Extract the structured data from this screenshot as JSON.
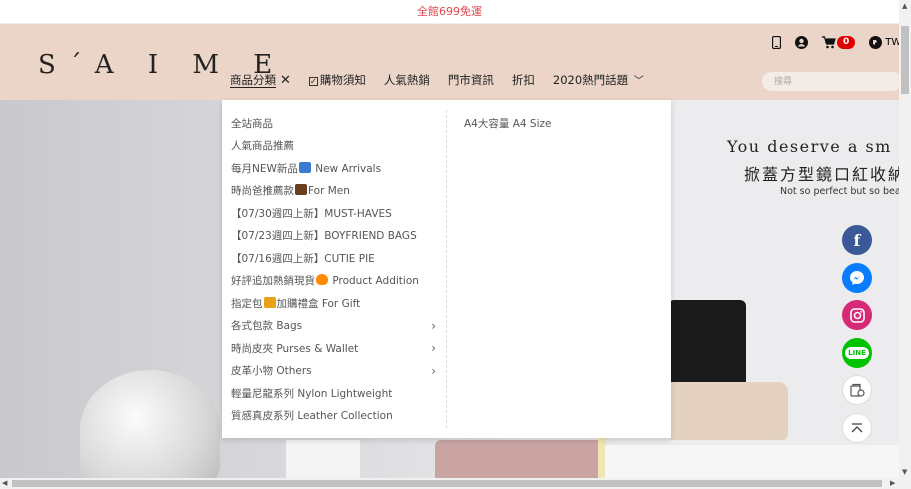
{
  "promo": {
    "text": "全館699免運"
  },
  "header": {
    "logo": "S´A I M E",
    "nav": [
      {
        "label": "商品分類"
      },
      {
        "label": "購物須知"
      },
      {
        "label": "人氣熱銷"
      },
      {
        "label": "門市資訊"
      },
      {
        "label": "折扣"
      },
      {
        "label": "2020熱門話題"
      }
    ],
    "cart_count": "0",
    "lang": "TWD",
    "search_placeholder": "搜尋"
  },
  "dropdown": {
    "left_items": [
      {
        "label": "全站商品"
      },
      {
        "label": "人氣商品推薦"
      },
      {
        "label_a": "每月NEW新品",
        "label_b": " New Arrivals"
      },
      {
        "label_a": "時尚爸推薦款",
        "label_b": "For Men"
      },
      {
        "label": "【07/30週四上新】MUST-HAVES"
      },
      {
        "label": "【07/23週四上新】BOYFRIEND BAGS"
      },
      {
        "label": "【07/16週四上新】CUTIE PIE"
      },
      {
        "label_a": "好評追加熱銷現貨",
        "label_b": " Product Addition"
      },
      {
        "label_a": "指定包",
        "label_b": "加購禮盒 For Gift"
      },
      {
        "label": "各式包款 Bags"
      },
      {
        "label": "時尚皮夾 Purses & Wallet"
      },
      {
        "label": "皮革小物 Others"
      },
      {
        "label": "輕量尼龍系列 Nylon Lightweight"
      },
      {
        "label": "質感真皮系列 Leather Collection"
      }
    ],
    "right_items": [
      {
        "label": "A4大容量 A4 Size"
      }
    ]
  },
  "hero": {
    "title": "You deserve a sm",
    "subtitle": "掀蓋方型鏡口紅收納",
    "small": "Not so perfect but so bea"
  },
  "social": {
    "facebook": "f",
    "line": "LINE"
  },
  "colors": {
    "header_bg": "#ead5c8",
    "promo_text": "#e0464e",
    "cart_badge": "#e00000"
  }
}
